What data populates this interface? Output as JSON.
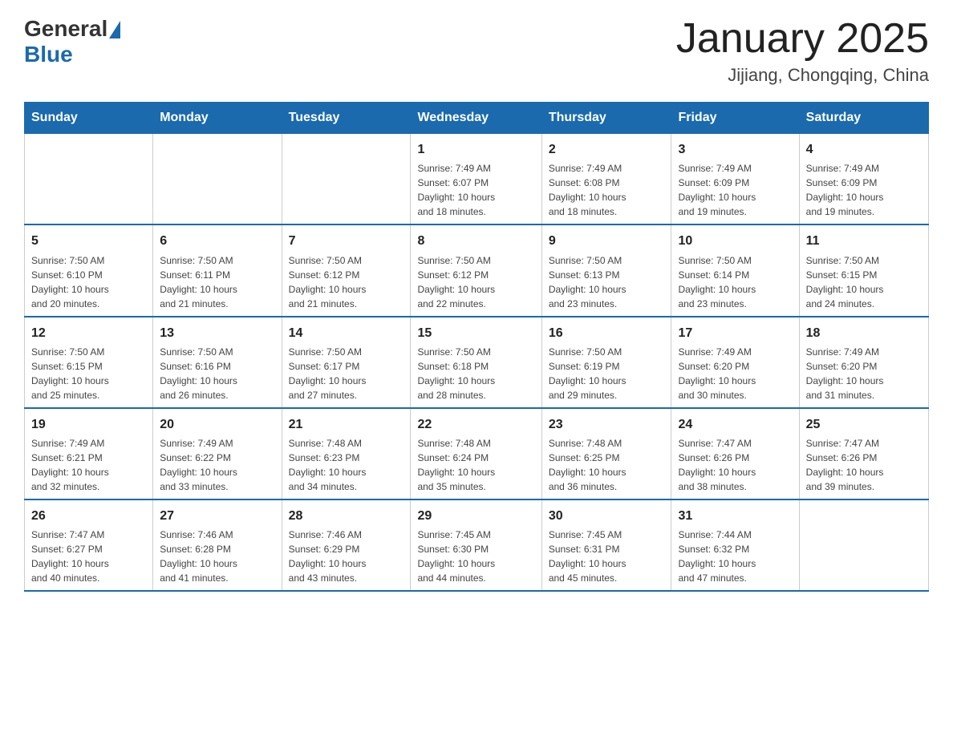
{
  "header": {
    "logo_general": "General",
    "logo_blue": "Blue",
    "month_title": "January 2025",
    "location": "Jijiang, Chongqing, China"
  },
  "days_of_week": [
    "Sunday",
    "Monday",
    "Tuesday",
    "Wednesday",
    "Thursday",
    "Friday",
    "Saturday"
  ],
  "weeks": [
    [
      {
        "day": "",
        "info": ""
      },
      {
        "day": "",
        "info": ""
      },
      {
        "day": "",
        "info": ""
      },
      {
        "day": "1",
        "info": "Sunrise: 7:49 AM\nSunset: 6:07 PM\nDaylight: 10 hours\nand 18 minutes."
      },
      {
        "day": "2",
        "info": "Sunrise: 7:49 AM\nSunset: 6:08 PM\nDaylight: 10 hours\nand 18 minutes."
      },
      {
        "day": "3",
        "info": "Sunrise: 7:49 AM\nSunset: 6:09 PM\nDaylight: 10 hours\nand 19 minutes."
      },
      {
        "day": "4",
        "info": "Sunrise: 7:49 AM\nSunset: 6:09 PM\nDaylight: 10 hours\nand 19 minutes."
      }
    ],
    [
      {
        "day": "5",
        "info": "Sunrise: 7:50 AM\nSunset: 6:10 PM\nDaylight: 10 hours\nand 20 minutes."
      },
      {
        "day": "6",
        "info": "Sunrise: 7:50 AM\nSunset: 6:11 PM\nDaylight: 10 hours\nand 21 minutes."
      },
      {
        "day": "7",
        "info": "Sunrise: 7:50 AM\nSunset: 6:12 PM\nDaylight: 10 hours\nand 21 minutes."
      },
      {
        "day": "8",
        "info": "Sunrise: 7:50 AM\nSunset: 6:12 PM\nDaylight: 10 hours\nand 22 minutes."
      },
      {
        "day": "9",
        "info": "Sunrise: 7:50 AM\nSunset: 6:13 PM\nDaylight: 10 hours\nand 23 minutes."
      },
      {
        "day": "10",
        "info": "Sunrise: 7:50 AM\nSunset: 6:14 PM\nDaylight: 10 hours\nand 23 minutes."
      },
      {
        "day": "11",
        "info": "Sunrise: 7:50 AM\nSunset: 6:15 PM\nDaylight: 10 hours\nand 24 minutes."
      }
    ],
    [
      {
        "day": "12",
        "info": "Sunrise: 7:50 AM\nSunset: 6:15 PM\nDaylight: 10 hours\nand 25 minutes."
      },
      {
        "day": "13",
        "info": "Sunrise: 7:50 AM\nSunset: 6:16 PM\nDaylight: 10 hours\nand 26 minutes."
      },
      {
        "day": "14",
        "info": "Sunrise: 7:50 AM\nSunset: 6:17 PM\nDaylight: 10 hours\nand 27 minutes."
      },
      {
        "day": "15",
        "info": "Sunrise: 7:50 AM\nSunset: 6:18 PM\nDaylight: 10 hours\nand 28 minutes."
      },
      {
        "day": "16",
        "info": "Sunrise: 7:50 AM\nSunset: 6:19 PM\nDaylight: 10 hours\nand 29 minutes."
      },
      {
        "day": "17",
        "info": "Sunrise: 7:49 AM\nSunset: 6:20 PM\nDaylight: 10 hours\nand 30 minutes."
      },
      {
        "day": "18",
        "info": "Sunrise: 7:49 AM\nSunset: 6:20 PM\nDaylight: 10 hours\nand 31 minutes."
      }
    ],
    [
      {
        "day": "19",
        "info": "Sunrise: 7:49 AM\nSunset: 6:21 PM\nDaylight: 10 hours\nand 32 minutes."
      },
      {
        "day": "20",
        "info": "Sunrise: 7:49 AM\nSunset: 6:22 PM\nDaylight: 10 hours\nand 33 minutes."
      },
      {
        "day": "21",
        "info": "Sunrise: 7:48 AM\nSunset: 6:23 PM\nDaylight: 10 hours\nand 34 minutes."
      },
      {
        "day": "22",
        "info": "Sunrise: 7:48 AM\nSunset: 6:24 PM\nDaylight: 10 hours\nand 35 minutes."
      },
      {
        "day": "23",
        "info": "Sunrise: 7:48 AM\nSunset: 6:25 PM\nDaylight: 10 hours\nand 36 minutes."
      },
      {
        "day": "24",
        "info": "Sunrise: 7:47 AM\nSunset: 6:26 PM\nDaylight: 10 hours\nand 38 minutes."
      },
      {
        "day": "25",
        "info": "Sunrise: 7:47 AM\nSunset: 6:26 PM\nDaylight: 10 hours\nand 39 minutes."
      }
    ],
    [
      {
        "day": "26",
        "info": "Sunrise: 7:47 AM\nSunset: 6:27 PM\nDaylight: 10 hours\nand 40 minutes."
      },
      {
        "day": "27",
        "info": "Sunrise: 7:46 AM\nSunset: 6:28 PM\nDaylight: 10 hours\nand 41 minutes."
      },
      {
        "day": "28",
        "info": "Sunrise: 7:46 AM\nSunset: 6:29 PM\nDaylight: 10 hours\nand 43 minutes."
      },
      {
        "day": "29",
        "info": "Sunrise: 7:45 AM\nSunset: 6:30 PM\nDaylight: 10 hours\nand 44 minutes."
      },
      {
        "day": "30",
        "info": "Sunrise: 7:45 AM\nSunset: 6:31 PM\nDaylight: 10 hours\nand 45 minutes."
      },
      {
        "day": "31",
        "info": "Sunrise: 7:44 AM\nSunset: 6:32 PM\nDaylight: 10 hours\nand 47 minutes."
      },
      {
        "day": "",
        "info": ""
      }
    ]
  ],
  "colors": {
    "header_bg": "#1a6aad",
    "header_text": "#ffffff",
    "border": "#1a6aad",
    "day_number_color": "#222222",
    "info_color": "#444444"
  }
}
